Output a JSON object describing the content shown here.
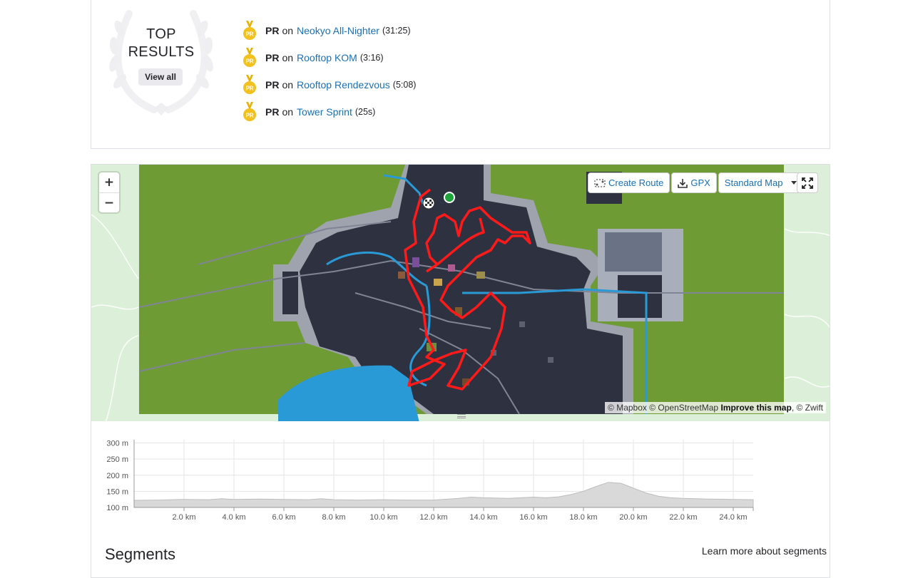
{
  "top_results": {
    "title_line1": "TOP",
    "title_line2": "RESULTS",
    "view_all_label": "View all",
    "badge_label": "PR",
    "on_word": "on",
    "items": [
      {
        "segment": "Neokyo All-Nighter",
        "time": "(31:25)"
      },
      {
        "segment": "Rooftop KOM",
        "time": "(3:16)"
      },
      {
        "segment": "Rooftop Rendezvous",
        "time": "(5:08)"
      },
      {
        "segment": "Tower Sprint",
        "time": "(25s)"
      }
    ]
  },
  "map": {
    "zoom_in": "+",
    "zoom_out": "−",
    "create_route_label": "Create Route",
    "gpx_label": "GPX",
    "map_style_label": "Standard Map",
    "attribution_prefix": "© Mapbox © OpenStreetMap",
    "attribution_improve": "Improve this map",
    "attribution_suffix": ", © Zwift",
    "route_color": "#ff1a1a",
    "water_color": "#2a9ad6",
    "land_color": "#6f9b35"
  },
  "elevation": {
    "y_ticks": [
      "300 m",
      "250 m",
      "200 m",
      "150 m",
      "100 m"
    ],
    "x_ticks": [
      "2.0 km",
      "4.0 km",
      "6.0 km",
      "8.0 km",
      "10.0 km",
      "12.0 km",
      "14.0 km",
      "16.0 km",
      "18.0 km",
      "20.0 km",
      "22.0 km",
      "24.0 km"
    ]
  },
  "chart_data": {
    "type": "area",
    "xlabel": "",
    "ylabel": "",
    "x_unit": "km",
    "y_unit": "m",
    "xlim": [
      0,
      24.8
    ],
    "ylim": [
      100,
      310
    ],
    "x": [
      0,
      1,
      2,
      3,
      3.5,
      4,
      5,
      6,
      7,
      7.5,
      8,
      9,
      10,
      11,
      12,
      13,
      13.5,
      14,
      15,
      16,
      16.5,
      17,
      17.5,
      18,
      18.5,
      19,
      19.5,
      20,
      20.5,
      21,
      21.5,
      22,
      23,
      24,
      24.8
    ],
    "y": [
      122,
      123,
      125,
      124,
      127,
      125,
      126,
      125,
      124,
      127,
      124,
      123,
      124,
      123,
      123,
      128,
      132,
      130,
      128,
      132,
      130,
      133,
      140,
      150,
      165,
      178,
      175,
      160,
      145,
      135,
      130,
      128,
      126,
      125,
      124
    ],
    "grid": true
  },
  "segments": {
    "title": "Segments",
    "learn_more": "Learn more about segments"
  }
}
